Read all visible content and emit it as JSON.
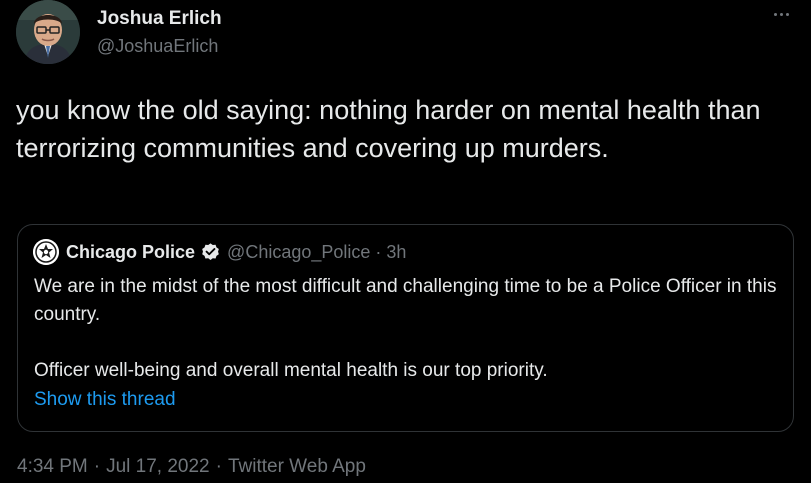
{
  "author": {
    "name": "Joshua Erlich",
    "handle": "@JoshuaErlich"
  },
  "tweet": {
    "text": "you know the old saying: nothing harder on mental health than terrorizing communities and covering up murders."
  },
  "quoted": {
    "name": "Chicago Police",
    "handle": "@Chicago_Police",
    "separator": "·",
    "time": "3h",
    "paragraph1": "We are in the midst of the most difficult and challenging time to be a Police Officer in this country.",
    "paragraph2": "Officer well-being and overall mental health is our top priority.",
    "show_thread": "Show this thread"
  },
  "meta": {
    "time": "4:34 PM",
    "date": "Jul 17, 2022",
    "separator": "·",
    "source": "Twitter Web App"
  },
  "colors": {
    "background": "#000000",
    "text": "#e7e9ea",
    "secondary": "#71767b",
    "link": "#1d9bf0",
    "border": "#2f3336"
  },
  "icons": [
    "more-icon",
    "verified-badge-icon",
    "police-star-icon"
  ]
}
